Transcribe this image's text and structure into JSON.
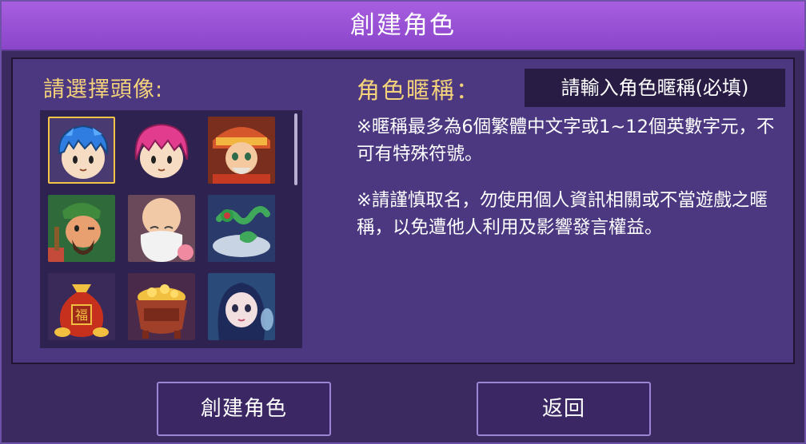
{
  "dialog": {
    "title": "創建角色",
    "avatar_label": "請選擇頭像:",
    "avatars": [
      {
        "name": "blue-hair-boy"
      },
      {
        "name": "pink-hair-girl"
      },
      {
        "name": "fortune-god"
      },
      {
        "name": "guan-gong"
      },
      {
        "name": "longevity-elder"
      },
      {
        "name": "jade-ruyi"
      },
      {
        "name": "fu-money-bag"
      },
      {
        "name": "gold-treasure-pot"
      },
      {
        "name": "blue-hair-lady"
      }
    ],
    "selected_avatar": 0,
    "nickname_label": "角色暱稱：",
    "nickname_placeholder": "請輸入角色暱稱(必填)",
    "notice_1": "※暱稱最多為6個繁體中文字或1~12個英數字元，不可有特殊符號。",
    "notice_2": "※請謹慎取名，勿使用個人資訊相關或不當遊戲之暱稱，以免遭他人利用及影響發言權益。",
    "create_button": "創建角色",
    "back_button": "返回"
  }
}
